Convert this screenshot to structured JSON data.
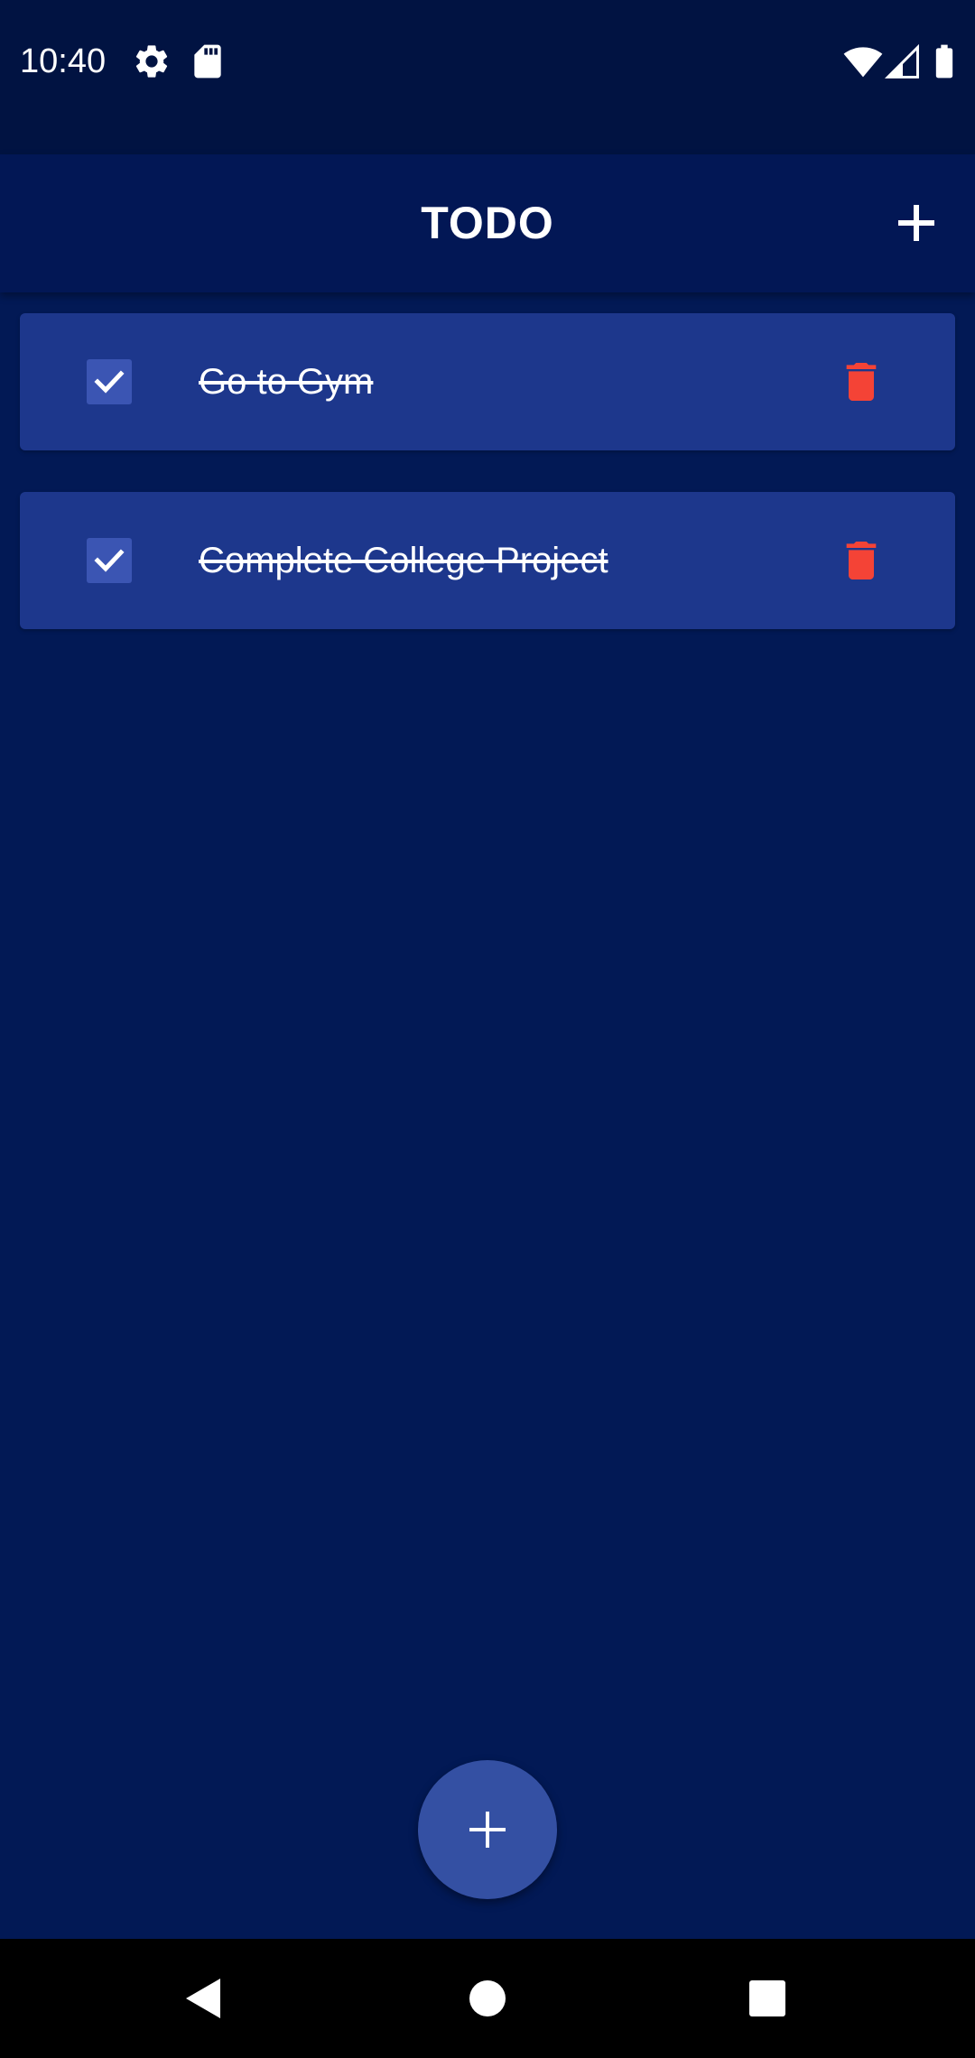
{
  "status_bar": {
    "time": "10:40",
    "left_icons": [
      "settings-icon",
      "sd-card-icon"
    ],
    "right_icons": [
      "wifi-icon",
      "cell-signal-icon",
      "battery-icon"
    ]
  },
  "app_bar": {
    "title": "TODO",
    "action_icon": "add-icon"
  },
  "todos": [
    {
      "text": "Go to Gym",
      "completed": true
    },
    {
      "text": "Complete College Project",
      "completed": true
    }
  ],
  "fab": {
    "icon": "add-icon"
  },
  "nav_bar": {
    "buttons": [
      "back-icon",
      "home-icon",
      "recents-icon"
    ]
  },
  "colors": {
    "background": "#021955",
    "status_bar": "#011342",
    "card": "#1d378c",
    "checkbox": "#3b55b3",
    "delete": "#f44336",
    "fab": "#3450a3"
  }
}
